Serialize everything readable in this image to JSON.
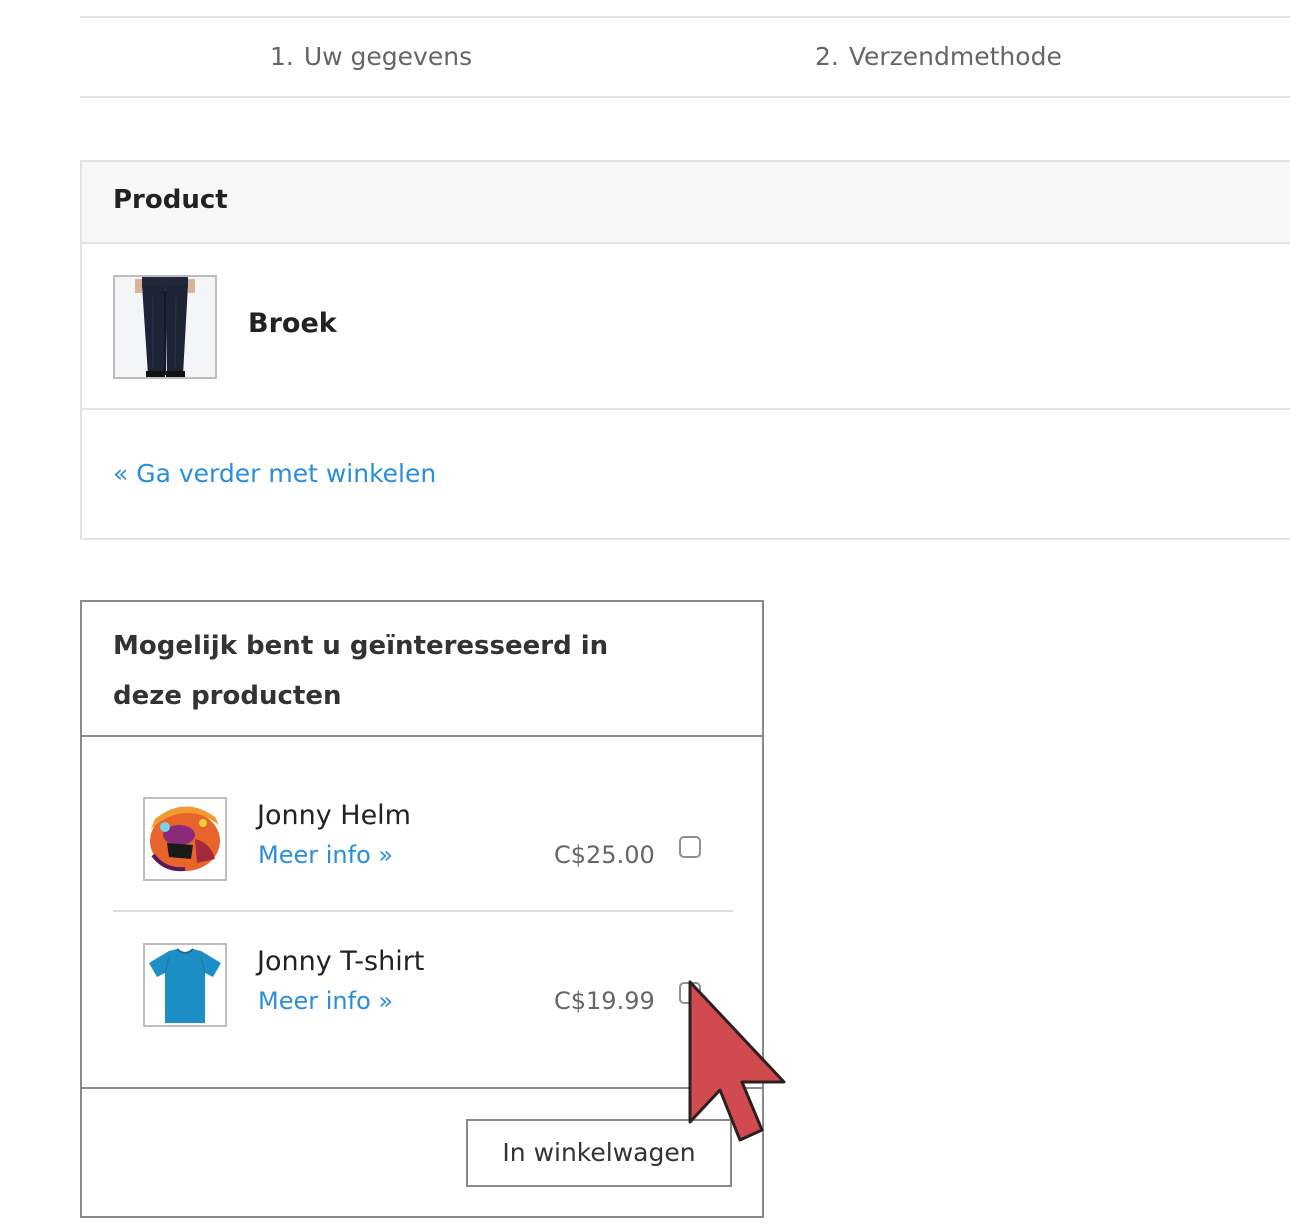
{
  "steps": [
    {
      "number": "1.",
      "label": "Uw gegevens"
    },
    {
      "number": "2.",
      "label": "Verzendmethode"
    }
  ],
  "cart": {
    "header": "Product",
    "item": {
      "name": "Broek",
      "image": "pants-photo"
    },
    "continue_link": "« Ga verder met winkelen"
  },
  "recommendations": {
    "title": "Mogelijk bent u geïnteresseerd in deze producten",
    "items": [
      {
        "name": "Jonny Helm",
        "more_info": "Meer info »",
        "price": "C$25.00",
        "image": "helmet-photo",
        "checked": false
      },
      {
        "name": "Jonny T-shirt",
        "more_info": "Meer info »",
        "price": "C$19.99",
        "image": "tshirt-photo",
        "checked": false
      }
    ],
    "add_button": "In winkelwagen"
  },
  "colors": {
    "link": "#2a8fd9",
    "cursor": "#d04a50"
  },
  "cursor_icon": "arrow-pointer-icon"
}
